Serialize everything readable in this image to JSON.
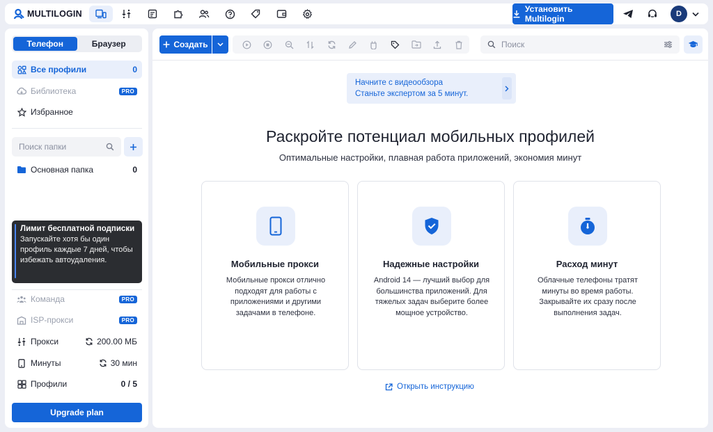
{
  "app": {
    "logo_text": "MULTILOGIN"
  },
  "topbar": {
    "nav": [
      {
        "name": "profiles-nav-icon",
        "active": true
      },
      {
        "name": "proxy-nav-icon",
        "active": false
      },
      {
        "name": "browser-nav-icon",
        "active": false
      },
      {
        "name": "extensions-nav-icon",
        "active": false
      },
      {
        "name": "team-nav-icon",
        "active": false
      },
      {
        "name": "help-nav-icon",
        "active": false
      },
      {
        "name": "tags-nav-icon",
        "active": false
      },
      {
        "name": "wallet-nav-icon",
        "active": false
      },
      {
        "name": "settings-nav-icon",
        "active": false
      }
    ],
    "install_label": "Установить Multilogin",
    "avatar_letter": "D"
  },
  "sidebar": {
    "tabs": [
      "Телефон",
      "Браузер"
    ],
    "all_profiles": {
      "label": "Все профили",
      "count": "0"
    },
    "library": {
      "label": "Библиотека",
      "badge": "PRO"
    },
    "favorites": {
      "label": "Избранное"
    },
    "folder_search_placeholder": "Поиск папки",
    "folder": {
      "label": "Основная папка",
      "count": "0"
    },
    "notice": {
      "title": "Лимит бесплатной подписки",
      "body": "Запускайте хотя бы один профиль каждые 7 дней, чтобы избежать автоудаления."
    },
    "team": {
      "label": "Команда",
      "badge": "PRO"
    },
    "isp": {
      "label": "ISP-прокси",
      "badge": "PRO"
    },
    "proxy": {
      "label": "Прокси",
      "value": "200.00 МБ"
    },
    "minutes": {
      "label": "Минуты",
      "value": "30 мин"
    },
    "profiles": {
      "label": "Профили",
      "value": "0 / 5"
    },
    "upgrade_label": "Upgrade plan"
  },
  "toolbar": {
    "create_label": "Создать",
    "search_placeholder": "Поиск"
  },
  "main": {
    "banner_line1": "Начните с видеообзора",
    "banner_line2": "Станьте экспертом за 5 минут.",
    "title": "Раскройте потенциал мобильных профилей",
    "subtitle": "Оптимальные настройки, плавная работа приложений, экономия минут",
    "cards": [
      {
        "title": "Мобильные прокси",
        "text": "Мобильные прокси отлично подходят для работы с приложениями и другими задачами в телефоне."
      },
      {
        "title": "Надежные настройки",
        "text": "Android 14 — лучший выбор для большинства приложений. Для тяжелых задач выберите более мощное устройство."
      },
      {
        "title": "Расход минут",
        "text": "Облачные телефоны тратят минуты во время работы. Закрывайте их сразу после выполнения задач."
      }
    ],
    "instruction_link": "Открыть инструкцию"
  },
  "colors": {
    "accent": "#1565d8",
    "accent_light": "#e9effb",
    "notice_bg": "#2b2d31"
  }
}
